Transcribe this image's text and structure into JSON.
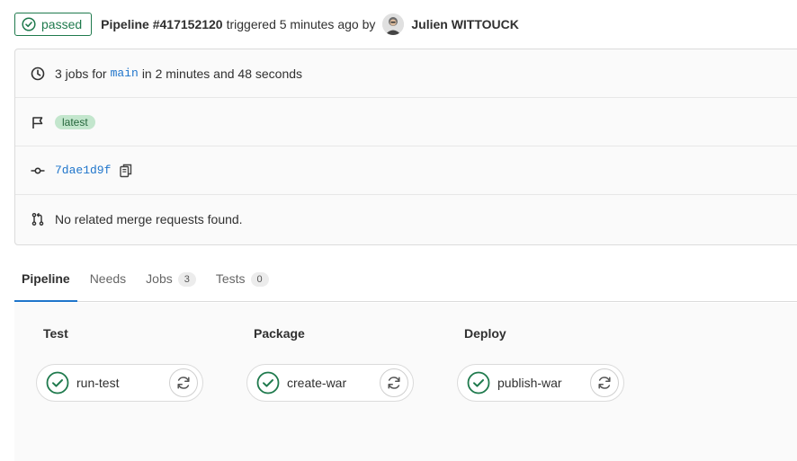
{
  "header": {
    "status": "passed",
    "pipeline_title": "Pipeline #417152120",
    "trigger_text": "triggered 5 minutes ago by",
    "author": "Julien WITTOUCK"
  },
  "info": {
    "jobs_prefix": "3 jobs for",
    "branch": "main",
    "duration": "in 2 minutes and 48 seconds",
    "latest_badge": "latest",
    "commit_sha": "7dae1d9f",
    "merge_requests": "No related merge requests found."
  },
  "tabs": [
    {
      "label": "Pipeline",
      "count": null
    },
    {
      "label": "Needs",
      "count": null
    },
    {
      "label": "Jobs",
      "count": "3"
    },
    {
      "label": "Tests",
      "count": "0"
    }
  ],
  "stages": [
    {
      "title": "Test",
      "job": "run-test"
    },
    {
      "title": "Package",
      "job": "create-war"
    },
    {
      "title": "Deploy",
      "job": "publish-war"
    }
  ],
  "colors": {
    "success": "#1f7a4d",
    "link": "#1f75cb",
    "latest_bg": "#c3e6cd"
  },
  "icons": {
    "status": "check-circle-icon",
    "clock": "clock-icon",
    "flag": "flag-icon",
    "commit": "commit-icon",
    "copy": "copy-icon",
    "merge_request": "merge-request-icon",
    "retry": "retry-icon"
  }
}
